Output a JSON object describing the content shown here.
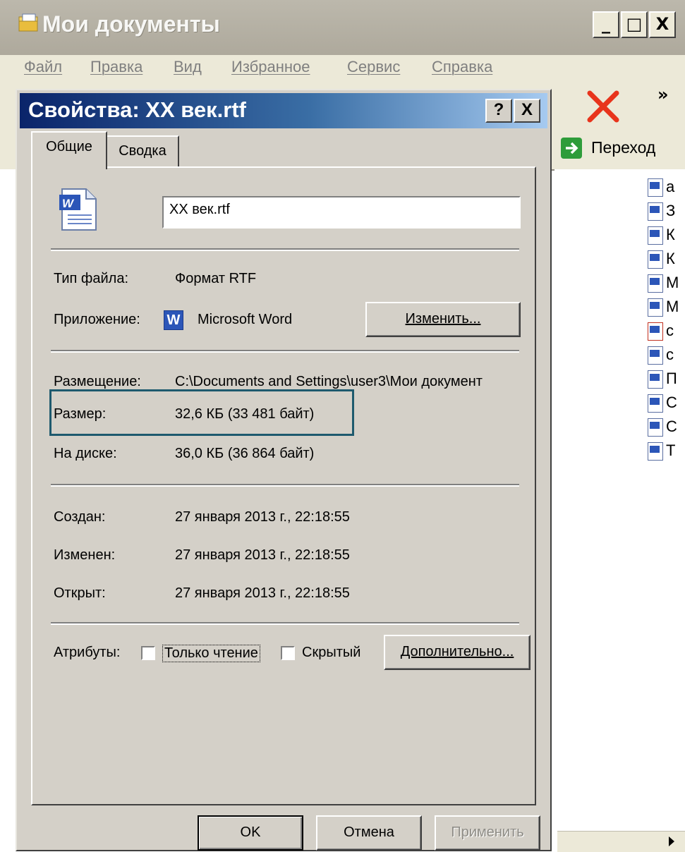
{
  "explorer": {
    "title": "Мои документы",
    "caption_buttons": {
      "minimize": "_",
      "maximize": "□",
      "close": "X"
    },
    "menu": [
      "Файл",
      "Правка",
      "Вид",
      "Избранное",
      "Сервис",
      "Справка"
    ],
    "toolbar_chevron": "»",
    "go_label": "Переход",
    "file_list_letters": [
      "а",
      "З",
      "К",
      "К",
      "М",
      "М",
      "с",
      "с",
      "П",
      "С",
      "С",
      "Т"
    ]
  },
  "dialog": {
    "title": "Свойства: XX век.rtf",
    "help_button": "?",
    "close_button": "X",
    "tabs": [
      "Общие",
      "Сводка"
    ],
    "active_tab": "Общие",
    "filename_value": "XX век.rtf",
    "file_type_label": "Тип файла:",
    "file_type_value": "Формат RTF",
    "app_label": "Приложение:",
    "app_value": "Microsoft Word",
    "app_icon_letter": "W",
    "change_button": "Изменить...",
    "location_label": "Размещение:",
    "location_value": "C:\\Documents and Settings\\user3\\Мои документ",
    "size_label": "Размер:",
    "size_value": "32,6 КБ (33 481 байт)",
    "on_disk_label": "На диске:",
    "on_disk_value": "36,0 КБ (36 864 байт)",
    "created_label": "Создан:",
    "created_value": "27 января 2013 г., 22:18:55",
    "modified_label": "Изменен:",
    "modified_value": "27 января 2013 г., 22:18:55",
    "opened_label": "Открыт:",
    "opened_value": "27 января 2013 г., 22:18:55",
    "attributes_label": "Атрибуты:",
    "readonly_label": "Только чтение",
    "readonly_checked": false,
    "hidden_label": "Скрытый",
    "hidden_checked": false,
    "advanced_button": "Дополнительно...",
    "ok_button": "OK",
    "cancel_button": "Отмена",
    "apply_button": "Применить"
  },
  "colors": {
    "dialog_face": "#d4d0c8",
    "title_gradient_start": "#0a246a",
    "title_gradient_end": "#a6caf0",
    "highlight_box": "#1e5a6e"
  }
}
